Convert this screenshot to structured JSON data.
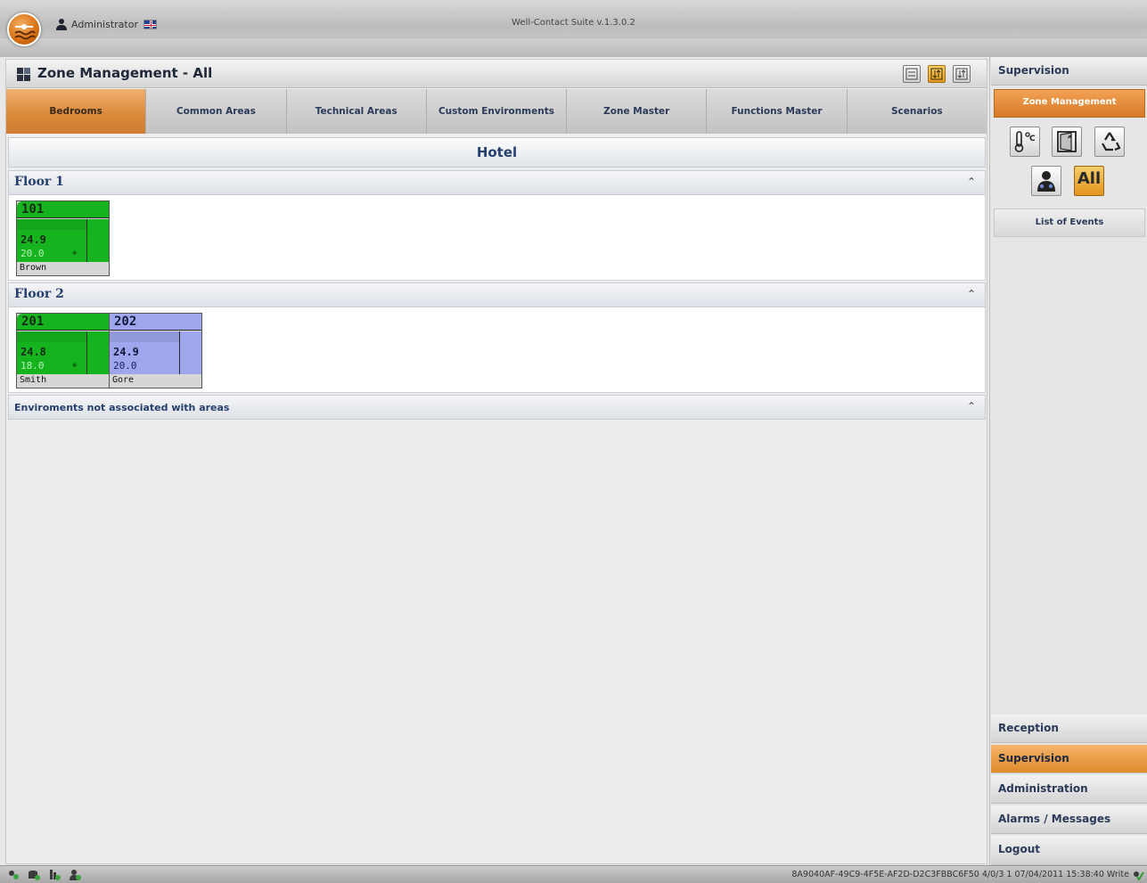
{
  "window": {
    "user": "Administrator",
    "app_title": "Well-Contact Suite v.1.3.0.2"
  },
  "header": {
    "title": "Zone Management - All",
    "view_buttons": [
      {
        "icon": "number-name-view-icon",
        "active": false
      },
      {
        "icon": "sort-view-icon",
        "active": true
      },
      {
        "icon": "reorder-view-icon",
        "active": false
      }
    ]
  },
  "tabs": [
    {
      "label": "Bedrooms",
      "active": true
    },
    {
      "label": "Common Areas",
      "active": false
    },
    {
      "label": "Technical Areas",
      "active": false
    },
    {
      "label": "Custom Environments",
      "active": false
    },
    {
      "label": "Zone Master",
      "active": false
    },
    {
      "label": "Functions Master",
      "active": false
    },
    {
      "label": "Scenarios",
      "active": false
    }
  ],
  "building": {
    "name": "Hotel",
    "floors": [
      {
        "label": "Floor 1",
        "rooms": [
          {
            "number": "101",
            "temp": "24.9",
            "setpoint": "20.0",
            "guest": "Brown",
            "status": "green"
          }
        ]
      },
      {
        "label": "Floor 2",
        "rooms": [
          {
            "number": "201",
            "temp": "24.8",
            "setpoint": "18.0",
            "guest": "Smith",
            "status": "green"
          },
          {
            "number": "202",
            "temp": "24.9",
            "setpoint": "20.0",
            "guest": "Gore",
            "status": "blue"
          }
        ]
      }
    ],
    "unassociated_label": "Enviroments not associated with areas"
  },
  "right_panel": {
    "section_top": "Supervision",
    "zone_management": "Zone Management",
    "filter_all": "All",
    "list_of_events": "List of Events",
    "menu": [
      {
        "label": "Reception",
        "active": false
      },
      {
        "label": "Supervision",
        "active": true
      },
      {
        "label": "Administration",
        "active": false
      },
      {
        "label": "Alarms / Messages",
        "active": false
      },
      {
        "label": "Logout",
        "active": false
      }
    ]
  },
  "status_bar": {
    "text": "8A9040AF-49C9-4F5E-AF2D-D2C3FBBC6F50 4/0/3 1 07/04/2011 15:38:40 Write"
  },
  "colors": {
    "accent_orange": "#e08a2a",
    "room_green": "#15b31e",
    "room_blue": "#9fa6ee",
    "title_blue": "#25406f"
  }
}
